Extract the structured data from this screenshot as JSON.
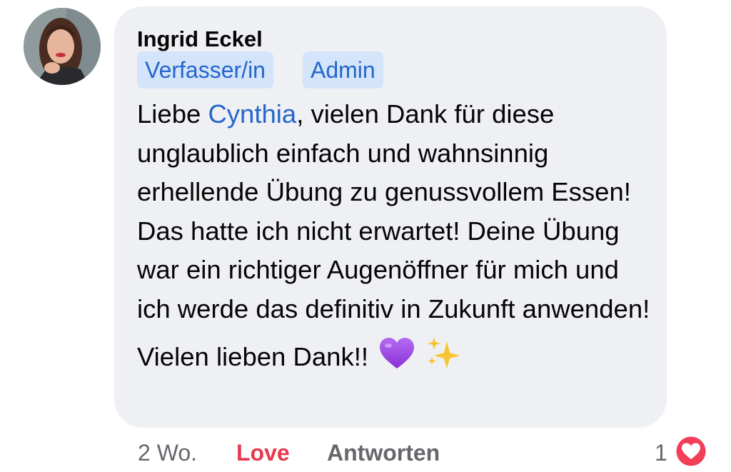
{
  "comment": {
    "author": "Ingrid Eckel",
    "badges": [
      "Verfasser/in",
      "Admin"
    ],
    "paragraph1": {
      "before_mention": "Liebe ",
      "mention": "Cynthia",
      "after_mention": ", vielen Dank für diese unglaublich einfach und wahnsinnig erhellende Übung zu genussvollem Essen! Das hatte ich nicht erwartet! Deine Übung war ein richtiger Augenöffner für mich und ich werde das definitiv in Zukunft anwenden!"
    },
    "paragraph2": "Vielen lieben Dank!!",
    "emojis": [
      "purple-heart-icon",
      "sparkles-icon"
    ]
  },
  "footer": {
    "time": "2 Wo.",
    "love_label": "Love",
    "reply_label": "Antworten",
    "reaction_count": "1",
    "reaction_icon": "love-reaction-icon"
  },
  "colors": {
    "bubble_bg": "#eff0f4",
    "badge_bg": "#d4e4fa",
    "link_blue": "#2466cc",
    "love_red": "#e8384f",
    "meta_gray": "#65676b"
  }
}
